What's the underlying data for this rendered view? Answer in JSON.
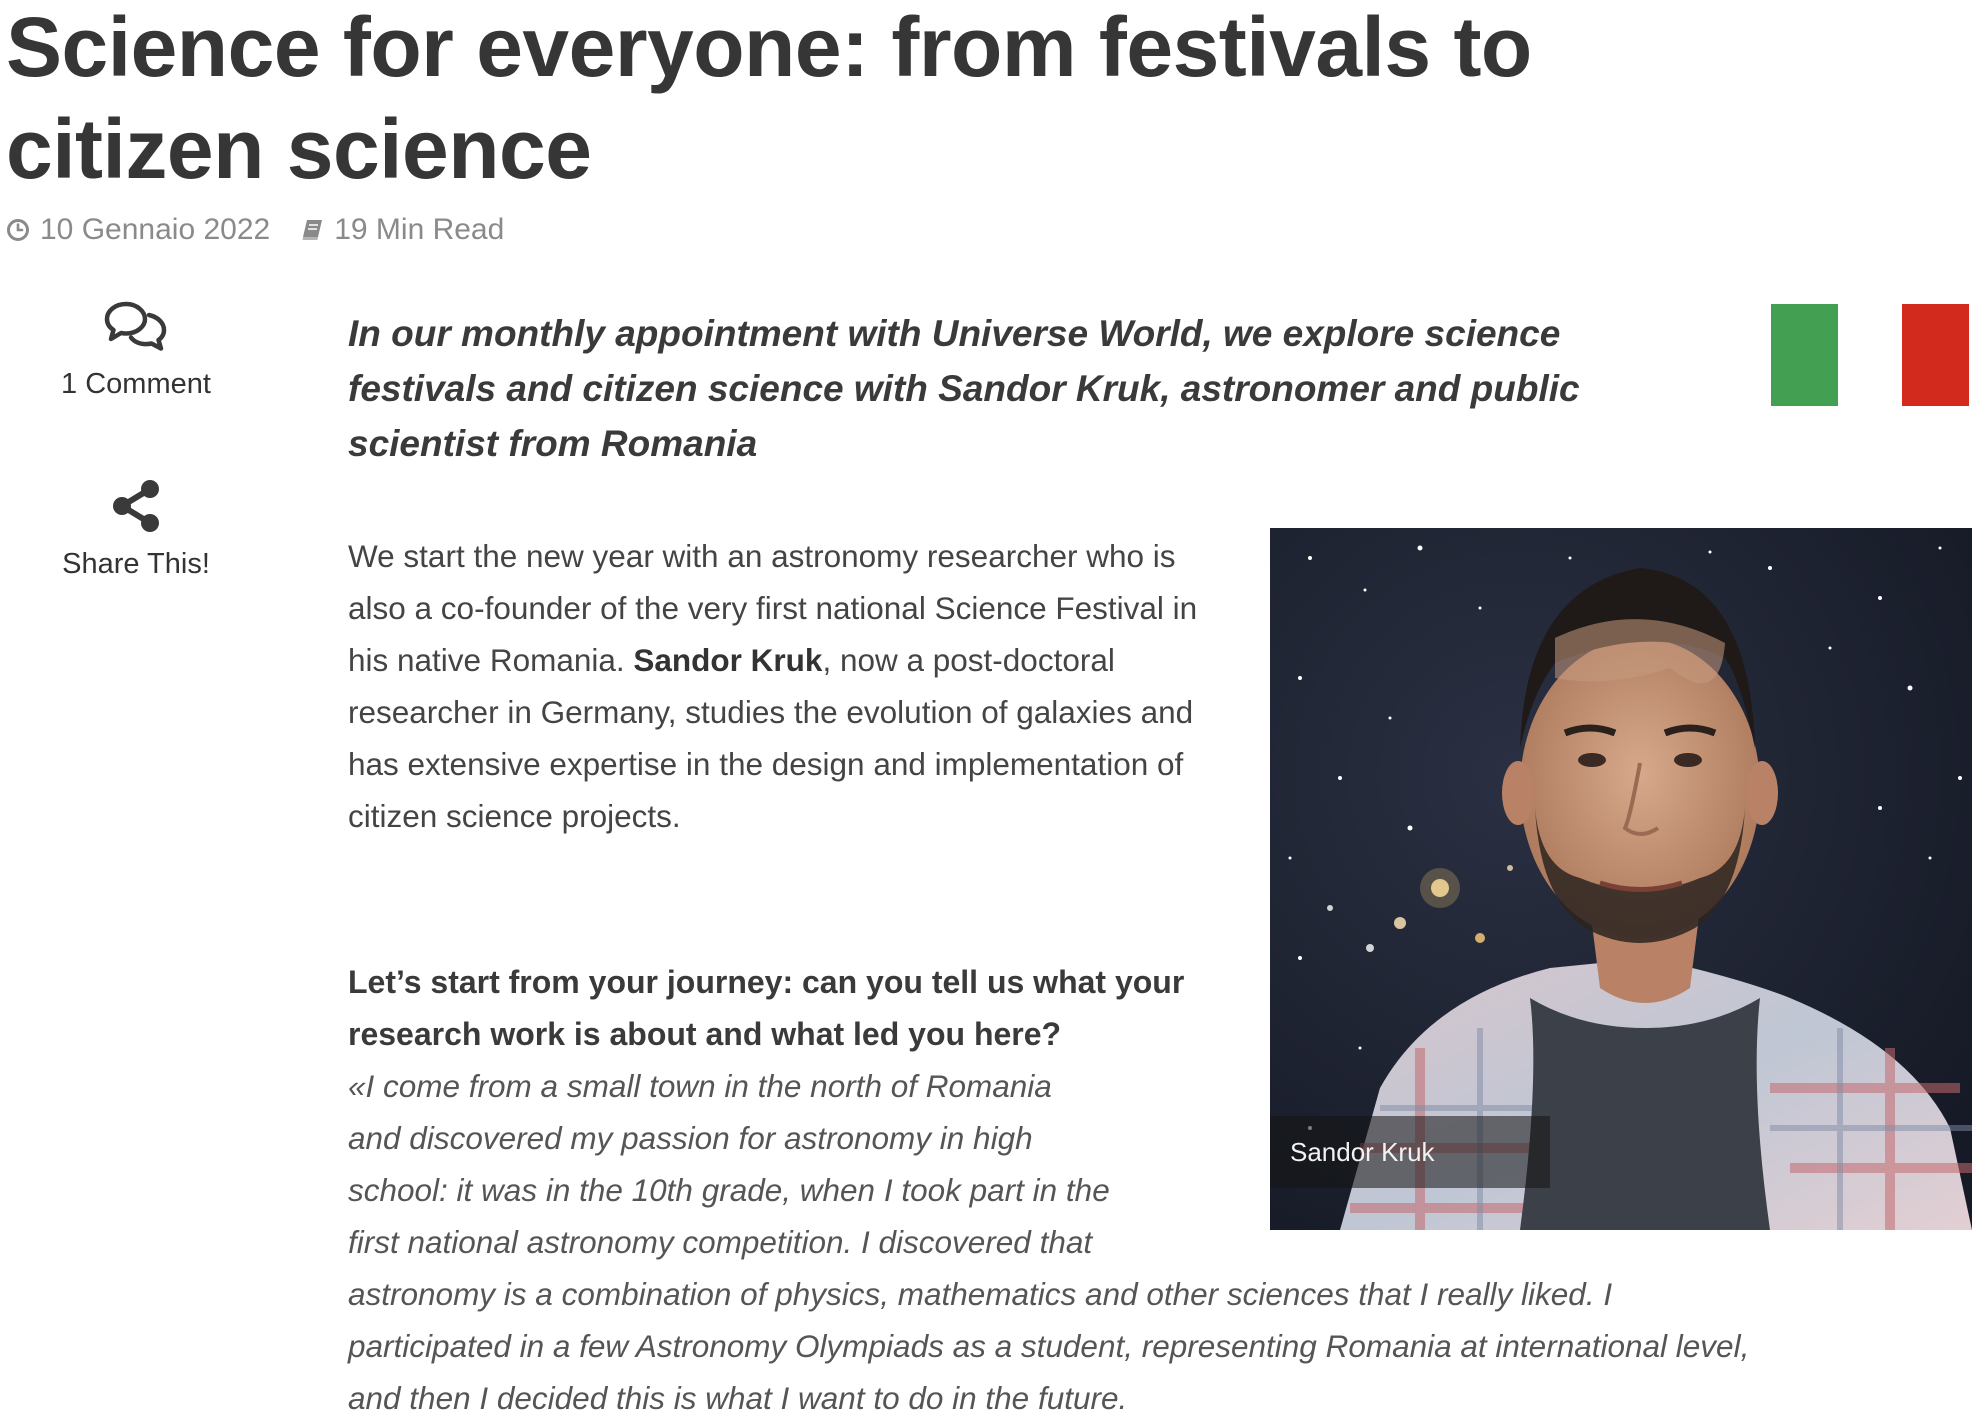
{
  "article": {
    "title": "Science for everyone: from festivals to citizen science",
    "date": "10 Gennaio 2022",
    "read_time": "19 Min Read",
    "intro": "In our monthly appointment with Universe World, we explore science festivals and citizen science with Sandor Kruk, astronomer and public scientist from Romania",
    "para1_before": "We start the new year with an astronomy researcher who is also a co-founder of the very first national Science Festival in his native Romania. ",
    "para1_name": "Sandor Kruk",
    "para1_after": ", now a post-doctoral researcher in Germany, studies the evolution of galaxies and has extensive expertise in the design and implementation of citizen science projects.",
    "question1": "Let’s start from your journey: can you tell us what your research work is about and what led you here?",
    "answer1_lines": [
      "«I come from a small town in the north of Romania",
      "and discovered my passion for astronomy in high",
      "school: it was in the 10th grade, when I took part in the",
      "first national astronomy competition. I discovered that",
      "astronomy is a combination of physics, mathematics and other sciences that I really liked. I",
      "participated in a few Astronomy Olympiads as a student, representing Romania at international level,",
      "and then I decided this is what I want to do in the future."
    ]
  },
  "sidebar": {
    "comments_label": "1 Comment",
    "share_label": "Share This!"
  },
  "photo": {
    "caption": "Sandor Kruk"
  },
  "icons": {
    "clock": "clock-icon",
    "book": "book-icon",
    "comments": "comments-icon",
    "share": "share-icon"
  },
  "colors": {
    "flag_green": "#43a052",
    "flag_red": "#d22b1e"
  }
}
